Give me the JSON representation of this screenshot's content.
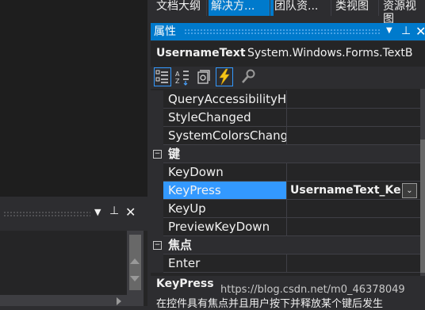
{
  "tabs": [
    "文档大纲",
    "解决方...",
    "团队资...",
    "类视图",
    "资源视图"
  ],
  "active_tab_index": 1,
  "properties_panel": {
    "title": "属性",
    "object_name": "UsernameText",
    "object_type": "System.Windows.Forms.TextB",
    "toolbar": {
      "icons": [
        "categorized-icon",
        "alphabetical-icon",
        "properties-icon",
        "events-icon",
        "property-pages-icon"
      ],
      "active": [
        "categorized-icon",
        "events-icon"
      ]
    },
    "rows": [
      {
        "kind": "item",
        "name": "QueryAccessibilityHe",
        "value": ""
      },
      {
        "kind": "item",
        "name": "StyleChanged",
        "value": ""
      },
      {
        "kind": "item",
        "name": "SystemColorsChange",
        "value": ""
      },
      {
        "kind": "category",
        "toggle": "⊟",
        "name": "键"
      },
      {
        "kind": "item",
        "name": "KeyDown",
        "value": ""
      },
      {
        "kind": "item",
        "name": "KeyPress",
        "value": "UsernameText_Key",
        "selected": true
      },
      {
        "kind": "item",
        "name": "KeyUp",
        "value": ""
      },
      {
        "kind": "item",
        "name": "PreviewKeyDown",
        "value": ""
      },
      {
        "kind": "category",
        "toggle": "⊟",
        "name": "焦点"
      },
      {
        "kind": "item",
        "name": "Enter",
        "value": ""
      }
    ],
    "description": {
      "title": "KeyPress",
      "text": "在控件具有焦点并且用户按下并释放某个键后发生"
    }
  },
  "watermark": "https://blog.csdn.net/m0_46378049",
  "colors": {
    "accent": "#007acc",
    "background": "#2d2d30",
    "editor": "#1e1e1e",
    "grid": "#252526",
    "selection": "#3399ff"
  }
}
